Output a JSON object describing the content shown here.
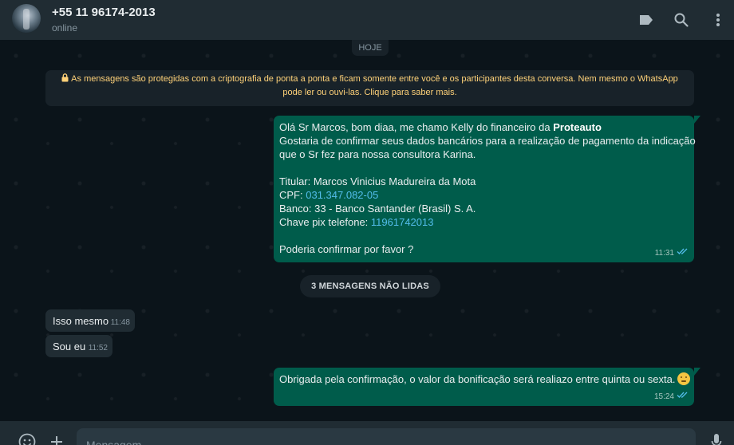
{
  "header": {
    "contact_name": "+55 11 96174-2013",
    "status": "online",
    "icons": [
      "label-icon",
      "search-icon",
      "menu-icon"
    ]
  },
  "chat": {
    "date_chip": "HOJE",
    "encryption_notice": "As mensagens são protegidas com a criptografia de ponta a ponta e ficam somente entre você e os participantes desta conversa. Nem mesmo o WhatsApp pode ler ou ouvi-las. Clique para saber mais.",
    "messages": [
      {
        "direction": "outgoing",
        "greeting": "Olá Sr Marcos, bom diaa, me chamo Kelly do financeiro da ",
        "company": "Proteauto",
        "line2": "Gostaria de confirmar seus dados bancários para a realização de pagamento da indicação",
        "line3": "que o Sr fez para nossa consultora Karina.",
        "titular": "Titular: Marcos Vinicius Madureira da Mota",
        "cpf_label": "CPF: ",
        "cpf_value": "031.347.082-05",
        "banco": "Banco: 33 - Banco Santander (Brasil) S. A.",
        "pix_label": "Chave pix telefone: ",
        "pix_value": "11961742013",
        "closing": "Poderia confirmar por favor ?",
        "time": "11:31",
        "status": "read"
      },
      {
        "direction": "incoming",
        "text": "Isso mesmo",
        "time": "11:48"
      },
      {
        "direction": "incoming",
        "text": "Sou eu",
        "time": "11:52"
      },
      {
        "direction": "outgoing",
        "text": "Obrigada pela confirmação, o valor da bonificação será realiazo entre quinta ou sexta.",
        "emoji": "thinking-face",
        "time": "15:24",
        "status": "read"
      }
    ],
    "unread_divider": "3 MENSAGENS NÃO LIDAS"
  },
  "footer": {
    "input_placeholder": "Mensagem",
    "icons": [
      "emoji-icon",
      "attach-plus-icon",
      "microphone-icon"
    ]
  },
  "colors": {
    "app_background": "#0b141a",
    "header_background": "#202c33",
    "outgoing_bubble": "#005c4b",
    "incoming_bubble": "#202c33",
    "link": "#53bdeb",
    "encryption_text": "#ffd279",
    "read_ticks": "#53bdeb"
  }
}
